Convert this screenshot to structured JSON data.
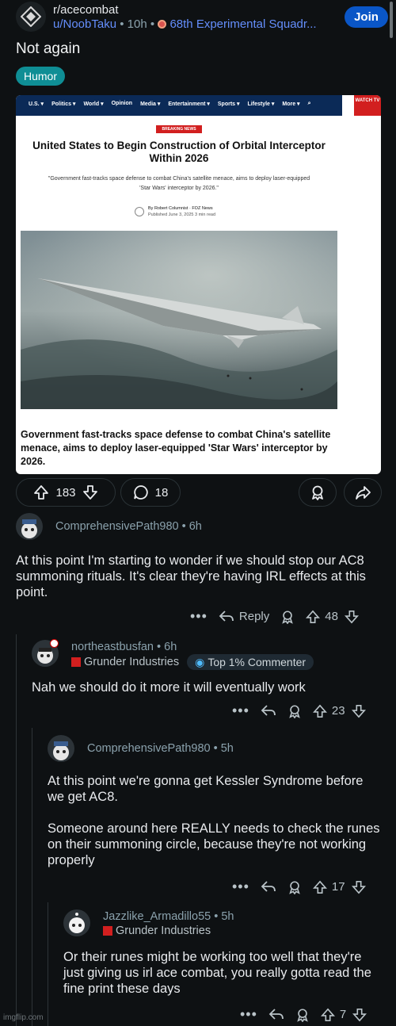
{
  "post": {
    "subreddit": "r/acecombat",
    "author": "u/NoobTaku",
    "age": "10h",
    "author_flair": "68th Experimental Squadr...",
    "join_label": "Join",
    "title": "Not again",
    "flair": "Humor",
    "upvotes": "183",
    "comments": "18"
  },
  "article": {
    "nav_items": [
      "U.S. ▾",
      "Politics ▾",
      "World ▾",
      "Opinion",
      "Media ▾",
      "Entertainment ▾",
      "Sports ▾",
      "Lifestyle ▾",
      "More ▾"
    ],
    "watch": "WATCH TV",
    "breaking": "BREAKING NEWS",
    "headline": "United States to Begin Construction of Orbital Interceptor Within 2026",
    "dek": "\"Government fast-tracks space defense to combat China's satellite menace, aims to deploy laser-equipped 'Star Wars' interceptor by 2026.\"",
    "byline_author": "By Robert Columnist · FOZ News",
    "byline_date": "Published June 3, 2025 3 min read",
    "caption": "Government fast-tracks space defense to combat China's satellite menace, aims to deploy laser-equipped 'Star Wars' interceptor by 2026."
  },
  "comments": [
    {
      "user": "ComprehensivePath980",
      "age": "6h",
      "text": "At this point I'm starting to wonder if we should stop our AC8 summoning rituals.  It's clear they're having IRL effects at this point.",
      "reply_label": "Reply",
      "score": "48"
    },
    {
      "user": "northeastbusfan",
      "age": "6h",
      "flair": "Grunder Industries",
      "top_badge": "Top 1% Commenter",
      "text": "Nah we should do it more it will eventually work",
      "score": "23"
    },
    {
      "user": "ComprehensivePath980",
      "age": "5h",
      "text1": "At this point we're gonna get Kessler Syndrome before we get AC8.",
      "text2": "Someone around here REALLY needs to check the runes on their summoning circle, because they're not working properly",
      "score": "17"
    },
    {
      "user": "Jazzlike_Armadillo55",
      "age": "5h",
      "flair": "Grunder Industries",
      "text": "Or their runes might be working too well that they're just giving us irl ace combat, you really gotta read the fine print these days",
      "score": "7"
    }
  ],
  "watermark": "imgflip.com",
  "colors": {
    "background": "#0e1113",
    "join": "#0a56c7",
    "flair": "#0f8e95",
    "link": "#648efc"
  }
}
